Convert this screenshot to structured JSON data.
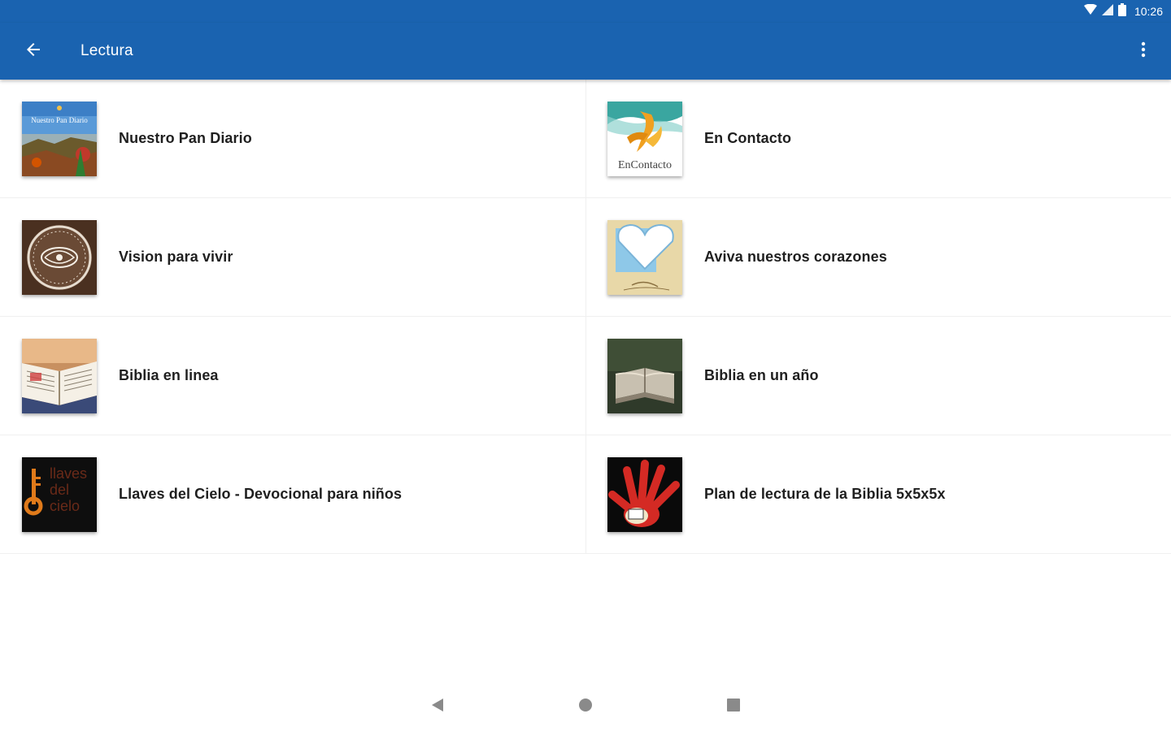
{
  "status_bar": {
    "time": "10:26",
    "icons": [
      "wifi-icon",
      "signal-icon",
      "battery-icon"
    ]
  },
  "app_bar": {
    "back_icon": "arrow-left-icon",
    "title": "Lectura",
    "overflow_icon": "more-vert-icon"
  },
  "items": [
    {
      "label": "Nuestro Pan Diario",
      "thumb_text": "Nuestro Pan Diario"
    },
    {
      "label": "En Contacto",
      "thumb_text": "EnContacto"
    },
    {
      "label": "Vision para vivir"
    },
    {
      "label": "Aviva nuestros corazones"
    },
    {
      "label": "Biblia en linea"
    },
    {
      "label": "Biblia en un año"
    },
    {
      "label": "Llaves del Cielo - Devocional para niños",
      "thumb_text": "llaves del cielo"
    },
    {
      "label": "Plan de lectura de la Biblia 5x5x5x"
    }
  ],
  "nav_bar": {
    "icons": [
      "nav-back-icon",
      "nav-home-icon",
      "nav-recents-icon"
    ]
  },
  "colors": {
    "primary": "#1a63b0",
    "background": "#ffffff"
  }
}
